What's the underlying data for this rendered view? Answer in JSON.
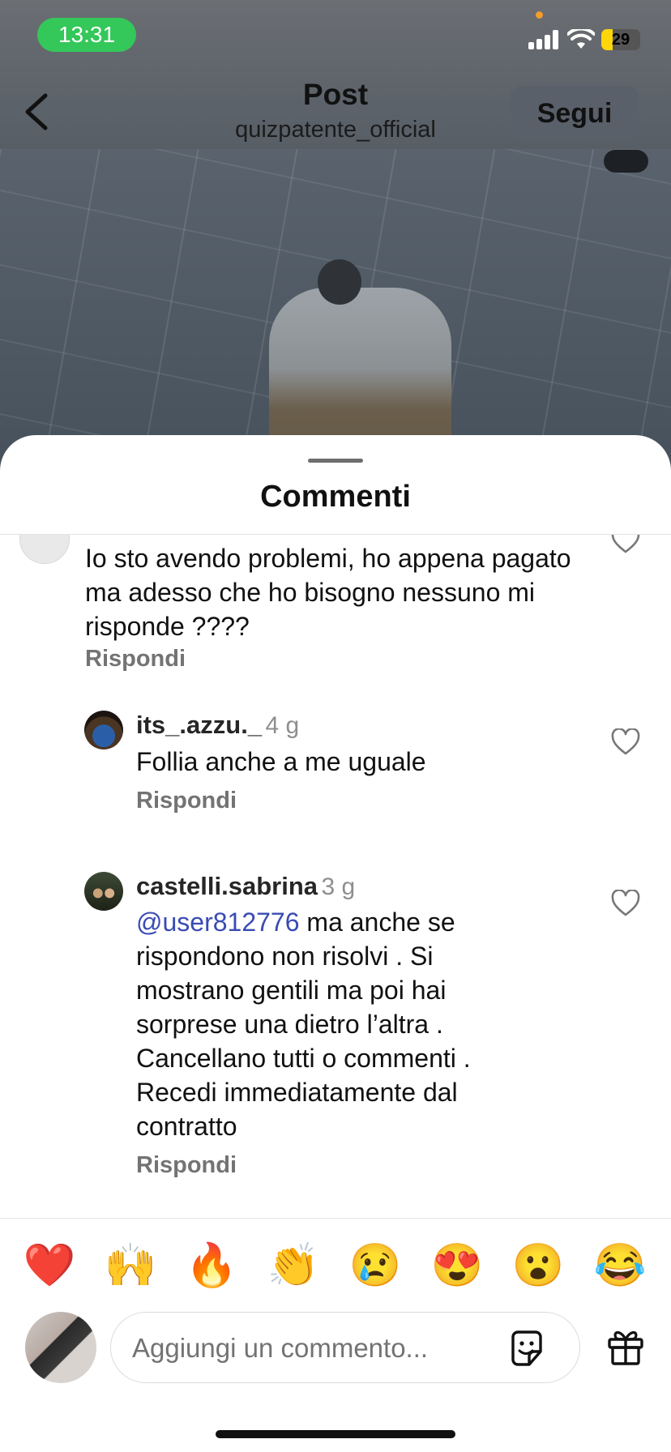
{
  "status_bar": {
    "time": "13:31",
    "battery": "29",
    "battery_fraction": 0.29
  },
  "header": {
    "title": "Post",
    "subtitle": "quizpatente_official",
    "follow_label": "Segui"
  },
  "sheet": {
    "title": "Commenti"
  },
  "comments": [
    {
      "text": "Io sto avendo problemi, ho appena pagato ma adesso che ho bisogno nessuno mi risponde ????",
      "reply_label": "Rispondi"
    },
    {
      "username": "its_.azzu._",
      "age": "4 g",
      "text": "Follia anche a me uguale",
      "reply_label": "Rispondi"
    },
    {
      "username": "castelli.sabrina",
      "age": "3 g",
      "mention": "@user812776",
      "text": " ma anche se rispondono non risolvi . Si mostrano gentili ma poi hai sorprese una dietro l’altra . Cancellano tutti o commenti . Recedi immediatamente dal contratto",
      "reply_label": "Rispondi"
    }
  ],
  "emoji_bar": [
    "❤️",
    "🙌",
    "🔥",
    "👏",
    "😢",
    "😍",
    "😮",
    "😂"
  ],
  "composer": {
    "placeholder": "Aggiungi un commento..."
  },
  "colors": {
    "time_pill": "#34c759",
    "mention": "#3a4bb4",
    "battery": "#ffd60a"
  }
}
